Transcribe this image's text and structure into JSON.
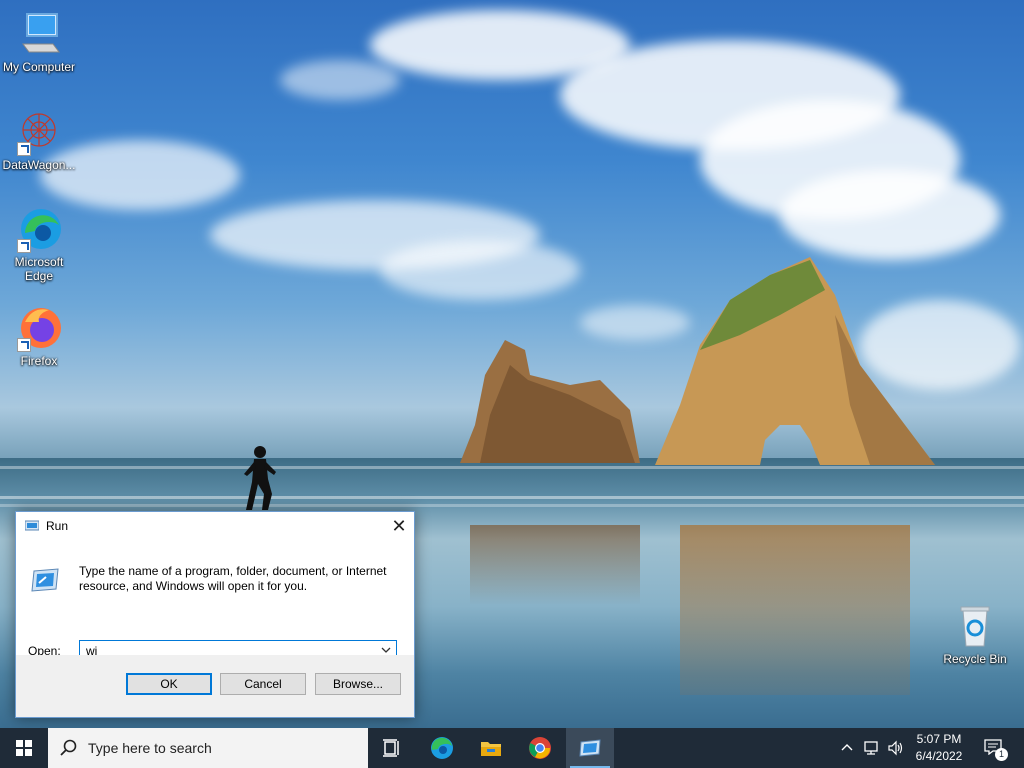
{
  "desktop": {
    "icons": [
      {
        "name": "my-computer",
        "label": "My Computer"
      },
      {
        "name": "datawagon",
        "label": "DataWagon..."
      },
      {
        "name": "microsoft-edge",
        "label": "Microsoft Edge"
      },
      {
        "name": "firefox",
        "label": "Firefox"
      },
      {
        "name": "recycle-bin",
        "label": "Recycle Bin"
      }
    ]
  },
  "run_dialog": {
    "title": "Run",
    "description": "Type the name of a program, folder, document, or Internet resource, and Windows will open it for you.",
    "open_label": "Open:",
    "open_value": "wi",
    "ok_label": "OK",
    "cancel_label": "Cancel",
    "browse_label": "Browse..."
  },
  "taskbar": {
    "search_placeholder": "Type here to search",
    "apps": [
      "task-view",
      "edge",
      "file-explorer",
      "chrome",
      "run"
    ],
    "time": "5:07 PM",
    "date": "6/4/2022",
    "notification_count": "1"
  },
  "colors": {
    "accent": "#0078d7",
    "taskbar": "#1f2b38"
  }
}
